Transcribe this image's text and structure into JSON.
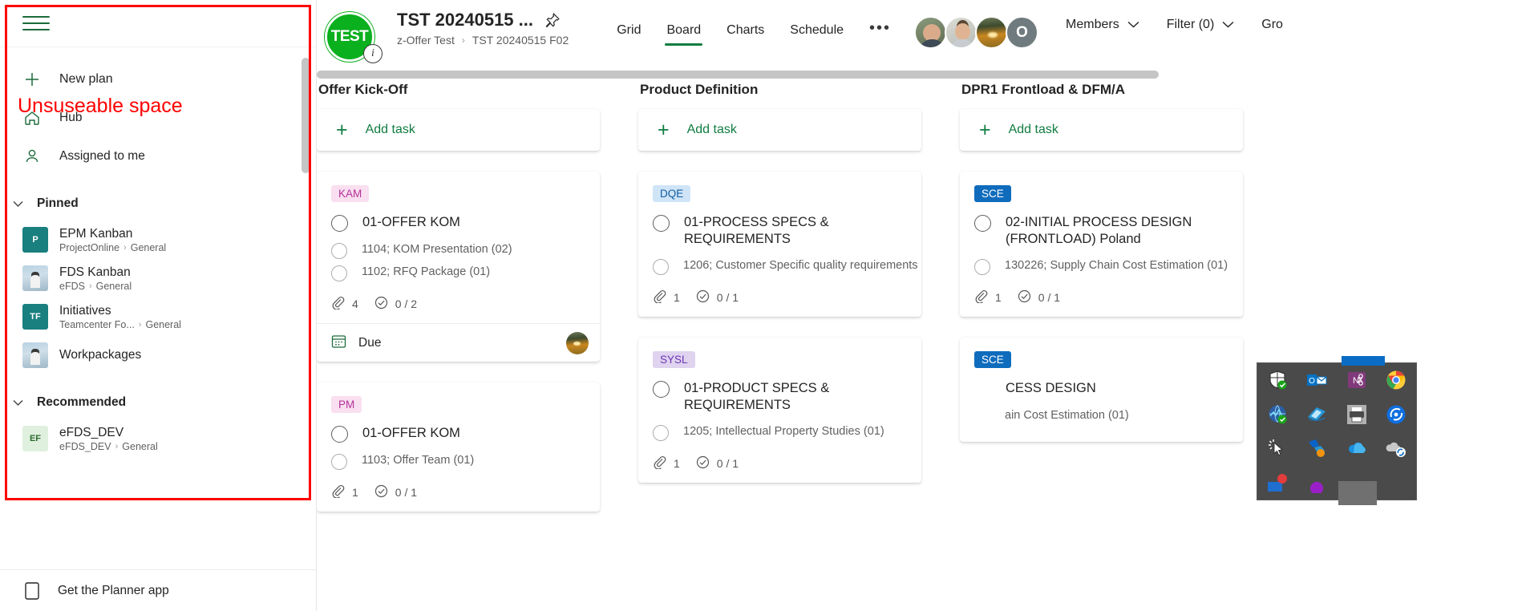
{
  "annotation": {
    "text": "Unsuseable space",
    "color": "#ff0000"
  },
  "sidebar": {
    "hamburger_label": "menu-icon",
    "new_plan": {
      "label": "New plan",
      "icon": "plus-icon"
    },
    "nav": [
      {
        "label": "Hub",
        "icon": "home-icon"
      },
      {
        "label": "Assigned to me",
        "icon": "person-icon"
      }
    ],
    "sections": [
      {
        "title": "Pinned",
        "items": [
          {
            "name": "EPM Kanban",
            "workspace": "ProjectOnline",
            "channel": "General",
            "avatar_type": "initials",
            "initials": "P",
            "avatar_color": "#1a7f7f"
          },
          {
            "name": "FDS Kanban",
            "workspace": "eFDS",
            "channel": "General",
            "avatar_type": "photo",
            "initials": "",
            "avatar_color": "#b9d2e3"
          },
          {
            "name": "Initiatives",
            "workspace": "Teamcenter Fo...",
            "channel": "General",
            "avatar_type": "initials",
            "initials": "TF",
            "avatar_color": "#1a7f7f"
          },
          {
            "name": "Workpackages",
            "workspace": "",
            "channel": "",
            "avatar_type": "photo",
            "initials": "",
            "avatar_color": "#b9d2e3"
          }
        ]
      },
      {
        "title": "Recommended",
        "items": [
          {
            "name": "eFDS_DEV",
            "workspace": "eFDS_DEV",
            "channel": "General",
            "avatar_type": "initials",
            "initials": "EF",
            "avatar_color": "#dff0df",
            "initials_color": "#2d6b2d"
          }
        ]
      }
    ],
    "footer": {
      "label": "Get the Planner app",
      "icon": "app-icon"
    }
  },
  "header": {
    "logo_text": "TEST",
    "logo_color": "#0ab01e",
    "info_badge": "i",
    "plan_title": "TST 20240515 ...",
    "pin_icon": "pin-icon",
    "breadcrumb": {
      "parent": "z-Offer Test",
      "separator": "›",
      "current": "TST 20240515 F02"
    },
    "tabs": [
      {
        "label": "Grid",
        "active": false
      },
      {
        "label": "Board",
        "active": true
      },
      {
        "label": "Charts",
        "active": false
      },
      {
        "label": "Schedule",
        "active": false
      }
    ],
    "more_tabs": "•••",
    "avatars": [
      {
        "name": "member-1"
      },
      {
        "name": "member-2"
      },
      {
        "name": "member-3"
      }
    ],
    "avatar_overflow": "O",
    "controls": [
      {
        "label": "Members",
        "chevron": "∨"
      },
      {
        "label": "Filter (0)",
        "chevron": "∨"
      },
      {
        "label": "Gro",
        "chevron": ""
      }
    ]
  },
  "board": {
    "add_task_label": "Add task",
    "columns": [
      {
        "title": "Offer Kick-Off",
        "cards": [
          {
            "badge": {
              "text": "KAM",
              "style": "kam"
            },
            "title": "01-OFFER KOM",
            "subtasks": [
              "1104; KOM Presentation (02)",
              "1102; RFQ Package (01)"
            ],
            "attachments": "4",
            "checklist": "0 / 2",
            "footer": {
              "due_label": "Due",
              "has_avatar": true
            }
          },
          {
            "badge": {
              "text": "PM",
              "style": "kam"
            },
            "title": "01-OFFER KOM",
            "subtasks": [
              "1103; Offer Team (01)"
            ],
            "attachments": "1",
            "checklist": "0 / 1",
            "footer": null
          }
        ]
      },
      {
        "title": "Product Definition",
        "cards": [
          {
            "badge": {
              "text": "DQE",
              "style": "dqe"
            },
            "title": "01-PROCESS SPECS & REQUIREMENTS",
            "subtasks": [
              "1206; Customer Specific quality requirements"
            ],
            "attachments": "1",
            "checklist": "0 / 1",
            "footer": null
          },
          {
            "badge": {
              "text": "SYSL",
              "style": "sysl"
            },
            "title": "01-PRODUCT SPECS & REQUIREMENTS",
            "subtasks": [
              "1205; Intellectual Property Studies (01)"
            ],
            "attachments": "1",
            "checklist": "0 / 1",
            "footer": null
          }
        ]
      },
      {
        "title": "DPR1 Frontload & DFM/A",
        "cards": [
          {
            "badge": {
              "text": "SCE",
              "style": "sce"
            },
            "title": "02-INITIAL PROCESS DESIGN (FRONTLOAD) Poland",
            "subtasks": [
              "130226; Supply Chain Cost Estimation (01)"
            ],
            "attachments": "1",
            "checklist": "0 / 1",
            "footer": null
          },
          {
            "badge": {
              "text": "SCE",
              "style": "sce"
            },
            "title": "CESS DESIGN",
            "subtasks": [
              "ain Cost Estimation (01)"
            ],
            "attachments": "",
            "checklist": "",
            "footer": null
          }
        ]
      }
    ]
  },
  "tray": {
    "icons": [
      "defender-shield-icon",
      "outlook-icon",
      "onenote-snip-icon",
      "chrome-icon",
      "network-monitor-icon",
      "media-app-icon",
      "printer-icon",
      "sync-app-icon",
      "cursor-busy-icon",
      "power-automate-icon",
      "onedrive-icon",
      "onedrive-sync-icon"
    ]
  }
}
